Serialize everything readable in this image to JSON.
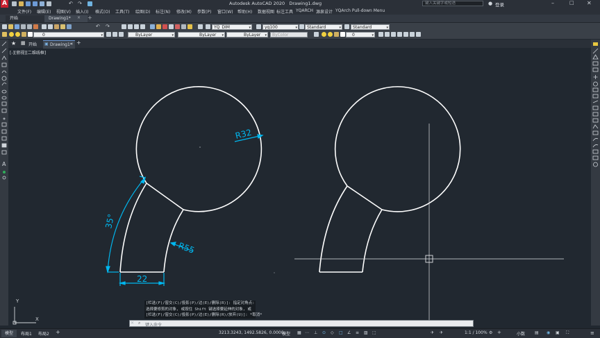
{
  "app": {
    "title": "Autodesk AutoCAD 2020",
    "document": "Drawing1.dwg",
    "search_placeholder": "键入关键字或短语",
    "login_label": "登录"
  },
  "menu": [
    "文件(F)",
    "编辑(E)",
    "视图(V)",
    "插入(I)",
    "格式(O)",
    "工具(T)",
    "绘图(D)",
    "标注(N)",
    "修改(M)",
    "参数(P)",
    "窗口(W)",
    "帮助(H)",
    "数据视图",
    "标注工具",
    "YQARCH",
    "源泉设计",
    "YQArch Pull-down Menu"
  ],
  "file_tabs": {
    "start": "开始",
    "drawing": "Drawing1*"
  },
  "toolbar1": {
    "layer_value": "0",
    "dimstyle": "YQ_DIM",
    "scale": "yq100",
    "textstyle": "Standard",
    "tablestyle": "Standard"
  },
  "toolbar2": {
    "color": "ByLayer",
    "linetype": "ByLayer",
    "lineweight": "ByLayer",
    "plotstyle": "ByColor",
    "layer_value": "0"
  },
  "doc_tabs": {
    "start": "开始",
    "drawing": "Drawing1*",
    "add": "+"
  },
  "viewport_label": "[-][俯视][二维线框]",
  "drawing": {
    "dim_radius_large": "R32",
    "dim_radius_arc": "R55",
    "dim_angle": "35°",
    "dim_linear": "22"
  },
  "ucs": {
    "x": "X",
    "y": "Y"
  },
  "command": {
    "lines": [
      "[栏选(F)/窗交(C)/投影(P)/边(E)/删除(R)]: 指定对角点:",
      "选择要修剪的对象, 或按住 Shift 键选择要延伸的对象, 或",
      "[栏选(F)/窗交(C)/投影(P)/边(E)/删除(R)/放弃(U)]: *取消*"
    ],
    "prompt": "键入命令"
  },
  "status": {
    "tabs": [
      "模型",
      "布局1",
      "布局2"
    ],
    "coords": "3213.3243, 1492.5826, 0.0000",
    "model_label": "模型",
    "scale": "1:1 / 100%",
    "unit": "小数"
  },
  "colors": {
    "background": "#212830",
    "dimension": "#00b7ef",
    "geometry": "#ffffff"
  }
}
